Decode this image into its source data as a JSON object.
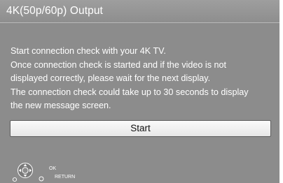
{
  "title": "4K(50p/60p) Output",
  "message_lines": [
    "Start connection check with your 4K TV.",
    "Once connection check is started and if the video is not",
    "displayed correctly, please wait for the next display.",
    "The connection check could take up to 30 seconds to display",
    "the new message screen."
  ],
  "start_button_label": "Start",
  "nav_hints": {
    "ok_label": "OK",
    "return_label": "RETURN",
    "dpad_icon": "dpad-icon",
    "return_icon": "return-circle-icon"
  },
  "colors": {
    "background": "#8c8c8c",
    "text": "#ffffff",
    "button": "#f2f2f2"
  }
}
